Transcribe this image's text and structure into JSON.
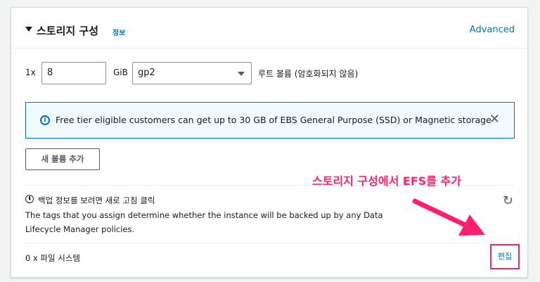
{
  "section": {
    "title": "스토리지 구성",
    "info_link": "정보",
    "advanced_link": "Advanced"
  },
  "volume": {
    "count_prefix": "1x",
    "size_value": "8",
    "size_unit": "GiB",
    "type_value": "gp2",
    "description": "루트 볼륨  (암호화되지 않음)"
  },
  "alert": {
    "icon": "info-icon",
    "text": "Free tier eligible customers can get up to 30 GB of EBS General Purpose (SSD) or Magnetic storage",
    "close_glyph": "✕"
  },
  "add_volume_button": "새 볼륨 추가",
  "backup": {
    "icon": "clock-icon",
    "title": "백업 정보를 보려면 새로 고침 클릭",
    "description": "The tags that you assign determine whether the instance will be backed up by any Data Lifecycle Manager policies.",
    "refresh_glyph": "↻"
  },
  "file_systems": {
    "label": "0 x 파일 시스템",
    "edit_link": "편집"
  },
  "annotation": {
    "text": "스토리지 구성에서 EFS를 추가",
    "color": "#ff1f6e"
  },
  "colors": {
    "link": "#0073bb",
    "alert_bg": "#f1faff",
    "highlight": "#ff1f6e"
  }
}
